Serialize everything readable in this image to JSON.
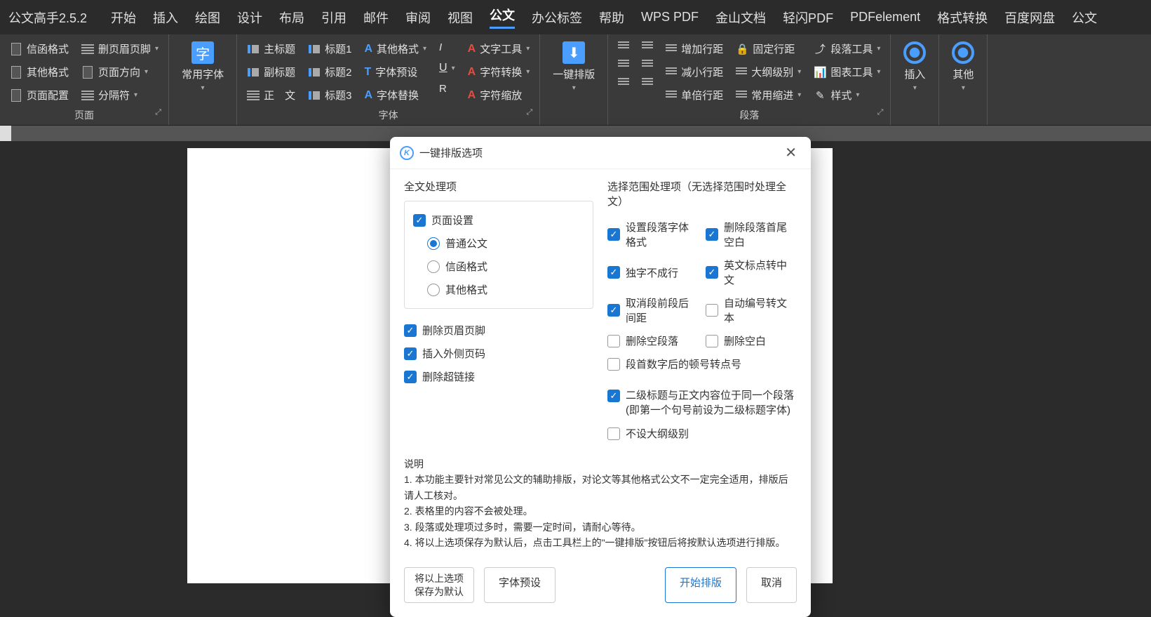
{
  "app_title": "公文高手2.5.2",
  "menu": [
    "开始",
    "插入",
    "绘图",
    "设计",
    "布局",
    "引用",
    "邮件",
    "审阅",
    "视图",
    "公文",
    "办公标签",
    "帮助",
    "WPS PDF",
    "金山文档",
    "轻闪PDF",
    "PDFelement",
    "格式转换",
    "百度网盘",
    "公文"
  ],
  "active_menu_index": 9,
  "ribbon": {
    "page": {
      "label": "页面",
      "letter_format": "信函格式",
      "other_format": "其他格式",
      "page_config": "页面配置",
      "del_header_footer": "删页眉页脚",
      "page_orient": "页面方向",
      "separator": "分隔符"
    },
    "common_font": "常用字体",
    "font": {
      "label": "字体",
      "main_title": "主标题",
      "sub_title": "副标题",
      "body": "正　文",
      "h1": "标题1",
      "h2": "标题2",
      "h3": "标题3",
      "other_format": "其他格式",
      "font_preset": "字体预设",
      "font_replace": "字体替换",
      "italic": "I",
      "underline": "U",
      "r": "R",
      "text_tools": "文字工具",
      "char_convert": "字符转换",
      "char_shrink": "字符缩放"
    },
    "one_key": "一键排版",
    "para": {
      "label": "段落",
      "inc_spacing": "增加行距",
      "dec_spacing": "减小行距",
      "single_spacing": "单倍行距",
      "fixed_spacing": "固定行距",
      "outline_level": "大纲级别",
      "common_indent": "常用缩进",
      "para_tools": "段落工具",
      "chart_tools": "图表工具",
      "style": "样式"
    },
    "insert": "插入",
    "other": "其他"
  },
  "dialog": {
    "title": "一键排版选项",
    "full_doc_section": "全文处理项",
    "range_section": "选择范围处理项（无选择范围时处理全文）",
    "page_setup": "页面设置",
    "normal_doc": "普通公文",
    "letter_format": "信函格式",
    "other_format": "其他格式",
    "del_header_footer": "删除页眉页脚",
    "insert_outer_page_num": "插入外侧页码",
    "del_hyperlink": "删除超链接",
    "set_para_font": "设置段落字体格式",
    "single_char_line": "独字不成行",
    "cancel_para_spacing": "取消段前段后间距",
    "del_empty_para": "删除空段落",
    "del_para_whitespace": "删除段落首尾空白",
    "en_punct_to_cn": "英文标点转中文",
    "auto_num_to_text": "自动编号转文本",
    "del_whitespace": "删除空白",
    "para_num_dot": "段首数字后的顿号转点号",
    "second_title_combo": "二级标题与正文内容位于同一个段落 (即第一个句号前设为二级标题字体)",
    "no_outline": "不设大纲级别",
    "desc_title": "说明",
    "desc_1": "1. 本功能主要针对常见公文的辅助排版，对论文等其他格式公文不一定完全适用，排版后请人工核对。",
    "desc_2": "2. 表格里的内容不会被处理。",
    "desc_3": "3. 段落或处理项过多时，需要一定时间，请耐心等待。",
    "desc_4": "4. 将以上选项保存为默认后，点击工具栏上的\"一键排版\"按钮后将按默认选项进行排版。",
    "btn_save_default": "将以上选项\n保存为默认",
    "btn_font_preset": "字体预设",
    "btn_start": "开始排版",
    "btn_cancel": "取消"
  }
}
